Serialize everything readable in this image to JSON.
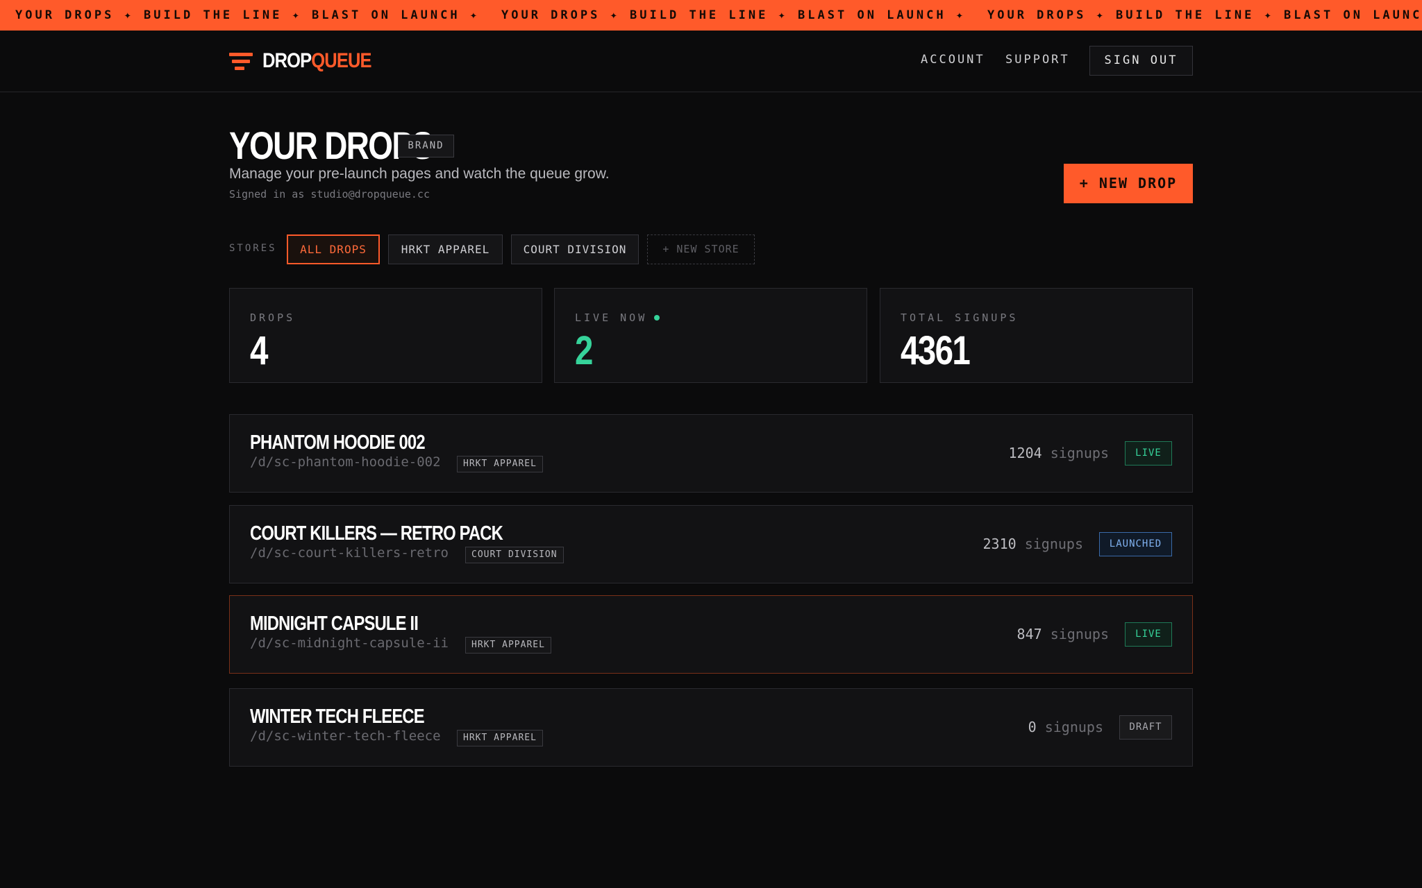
{
  "ticker": {
    "text": "YOUR DROPS ✦ BUILD THE LINE ✦ BLAST ON LAUNCH ✦"
  },
  "header": {
    "logo_drop": "DROP",
    "logo_queue": "QUEUE",
    "nav": {
      "account": "ACCOUNT",
      "support": "SUPPORT",
      "sign_out": "SIGN OUT"
    }
  },
  "page": {
    "title": "YOUR DROPS",
    "badge": "BRAND",
    "subtitle": "Manage your pre-launch pages and watch the queue grow.",
    "signed_in": "Signed in as studio@dropqueue.cc",
    "new_drop": "+ NEW DROP"
  },
  "stores": {
    "label": "STORES",
    "chips": [
      "ALL DROPS",
      "HRKT APPAREL",
      "COURT DIVISION",
      "+ NEW STORE"
    ],
    "active_index": 0
  },
  "stats": [
    {
      "label": "DROPS",
      "value": "4"
    },
    {
      "label": "LIVE NOW",
      "value": "2"
    },
    {
      "label": "TOTAL SIGNUPS",
      "value": "4361"
    }
  ],
  "drops": [
    {
      "name": "PHANTOM HOODIE 002",
      "path": "/d/sc-phantom-hoodie-002",
      "store": "HRKT APPAREL",
      "signups": "1204",
      "signups_label": "signups",
      "status": "LIVE"
    },
    {
      "name": "COURT KILLERS — RETRO PACK",
      "path": "/d/sc-court-killers-retro",
      "store": "COURT DIVISION",
      "signups": "2310",
      "signups_label": "signups",
      "status": "LAUNCHED"
    },
    {
      "name": "MIDNIGHT CAPSULE II",
      "path": "/d/sc-midnight-capsule-ii",
      "store": "HRKT APPAREL",
      "signups": "847",
      "signups_label": "signups",
      "status": "LIVE"
    },
    {
      "name": "WINTER TECH FLEECE",
      "path": "/d/sc-winter-tech-fleece",
      "store": "HRKT APPAREL",
      "signups": "0",
      "signups_label": "signups",
      "status": "DRAFT"
    }
  ],
  "icons": {
    "logo": "queue-stack-icon",
    "live_indicator": "live-dot-icon"
  },
  "colors": {
    "accent": "#ff5a2a",
    "background": "#0b0b0c",
    "live": "#36d39a",
    "launched": "#7fb0ee"
  }
}
